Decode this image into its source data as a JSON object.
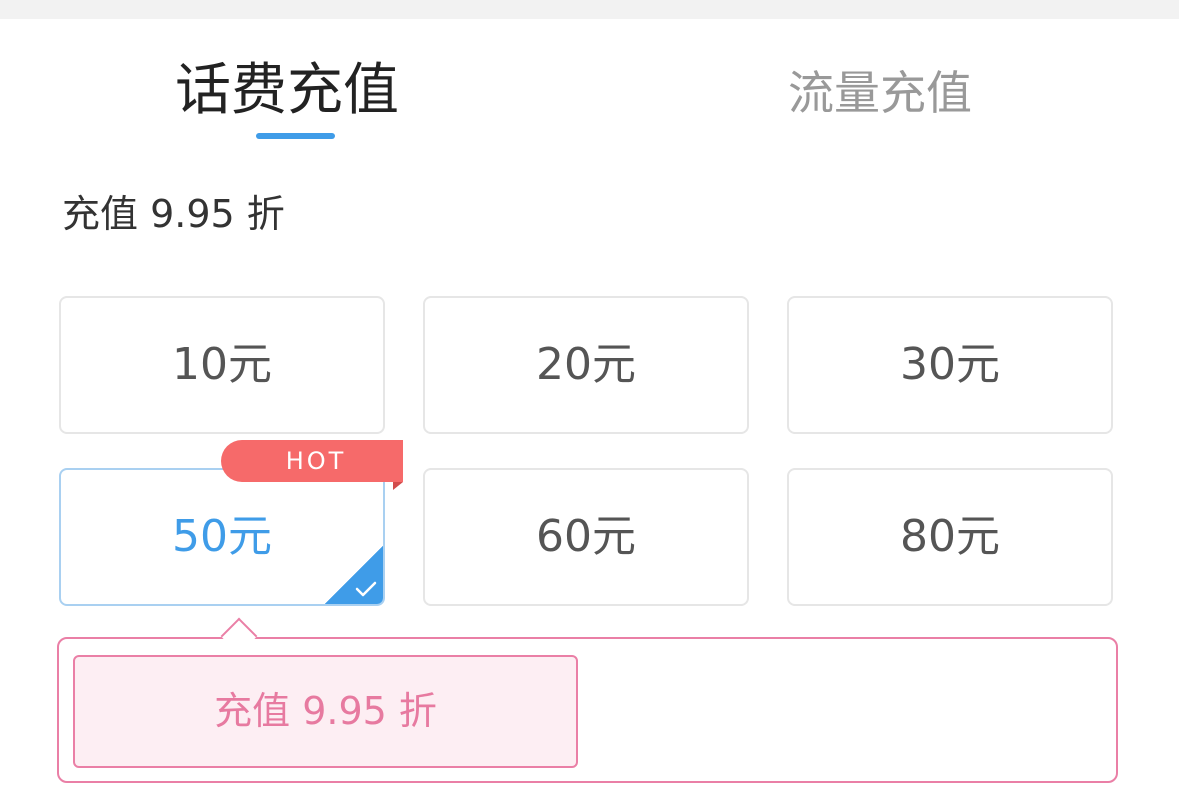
{
  "tabs": [
    {
      "label": "话费充值",
      "active": true
    },
    {
      "label": "流量充值",
      "active": false
    }
  ],
  "discount_label": "充值 9.95 折",
  "options": [
    {
      "label": "10元"
    },
    {
      "label": "20元"
    },
    {
      "label": "30元"
    },
    {
      "label": "50元",
      "selected": true,
      "badge": "HOT"
    },
    {
      "label": "60元"
    },
    {
      "label": "80元"
    }
  ],
  "promo": {
    "label": "充值 9.95 折"
  },
  "colors": {
    "accent": "#3f9ce8",
    "hot": "#f66a6a",
    "promo": "#ea7fa6"
  }
}
